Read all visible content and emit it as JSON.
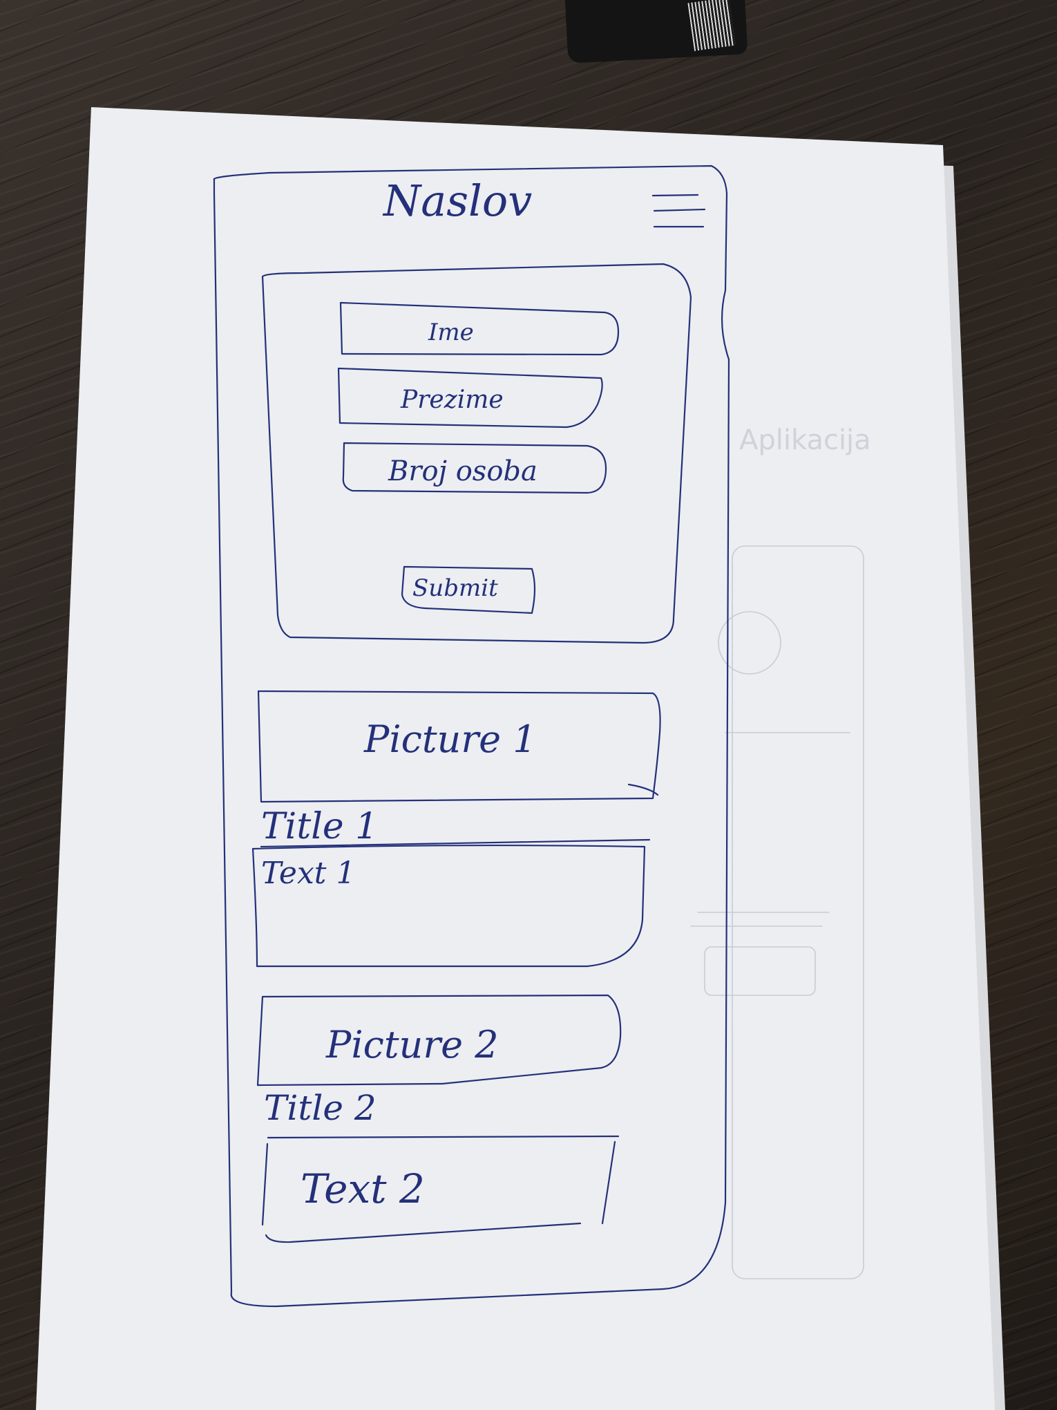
{
  "header": {
    "title": "Naslov",
    "menu_icon": "hamburger-menu-icon"
  },
  "form": {
    "fields": [
      {
        "label": "Ime"
      },
      {
        "label": "Prezime"
      },
      {
        "label": "Broj osoba"
      }
    ],
    "submit_label": "Submit"
  },
  "cards": [
    {
      "picture": "Picture 1",
      "title": "Title 1",
      "text": "Text 1"
    },
    {
      "picture": "Picture 2",
      "title": "Title 2",
      "text": "Text 2"
    }
  ],
  "colors": {
    "ink": "#24307a",
    "paper": "#eceef1",
    "table": "#2b2522"
  }
}
